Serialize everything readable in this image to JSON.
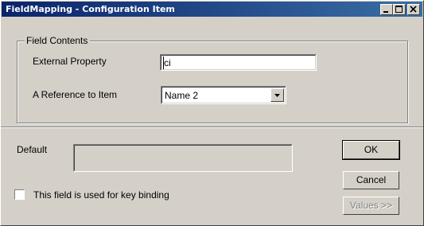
{
  "window": {
    "title": "FieldMapping - Configuration Item",
    "controls": [
      "minimize-icon",
      "maximize-icon",
      "close-icon"
    ]
  },
  "field_contents": {
    "legend": "Field Contents",
    "external_property_label": "External Property",
    "external_property_value": "ci",
    "reference_label": "A Reference to Item",
    "reference_selected": "Name 2"
  },
  "default_label": "Default",
  "default_value": "",
  "key_binding": {
    "label": "This field is used for key binding",
    "checked": false
  },
  "buttons": {
    "ok": "OK",
    "cancel": "Cancel",
    "values": "Values >>"
  }
}
